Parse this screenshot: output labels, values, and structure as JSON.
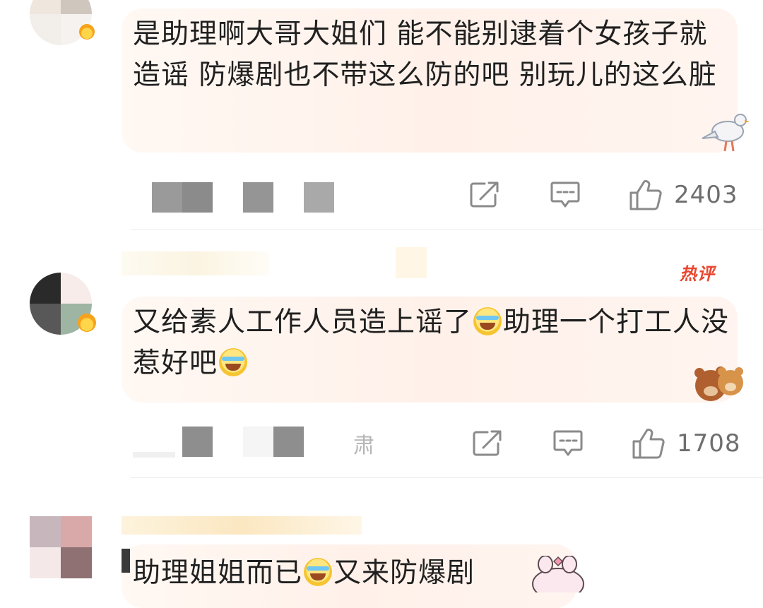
{
  "comments": [
    {
      "text": "是助理啊大哥大姐们 能不能别逮着个女孩子就造谣 防爆剧也不带这么防的吧 别玩儿的这么脏",
      "likes": "2403",
      "hot_label": ""
    },
    {
      "text_parts": [
        "又给素人工作人员造上谣了",
        "助理一个打工人没惹好吧",
        ""
      ],
      "likes": "1708",
      "hot_label": "热评",
      "meta_fragment": "肃"
    },
    {
      "text_parts": [
        "助理姐姐而已",
        "又来防爆剧"
      ],
      "likes": "",
      "hot_label": ""
    }
  ],
  "icons": {
    "repost": "repost-icon",
    "reply": "comment-icon",
    "like": "thumbs-up-icon",
    "emoji": "laugh-cry-emoji"
  },
  "colors": {
    "accent_hot": "#e8462e",
    "icon_gray": "#8a8a8a",
    "bubble": "#fff3ec"
  }
}
